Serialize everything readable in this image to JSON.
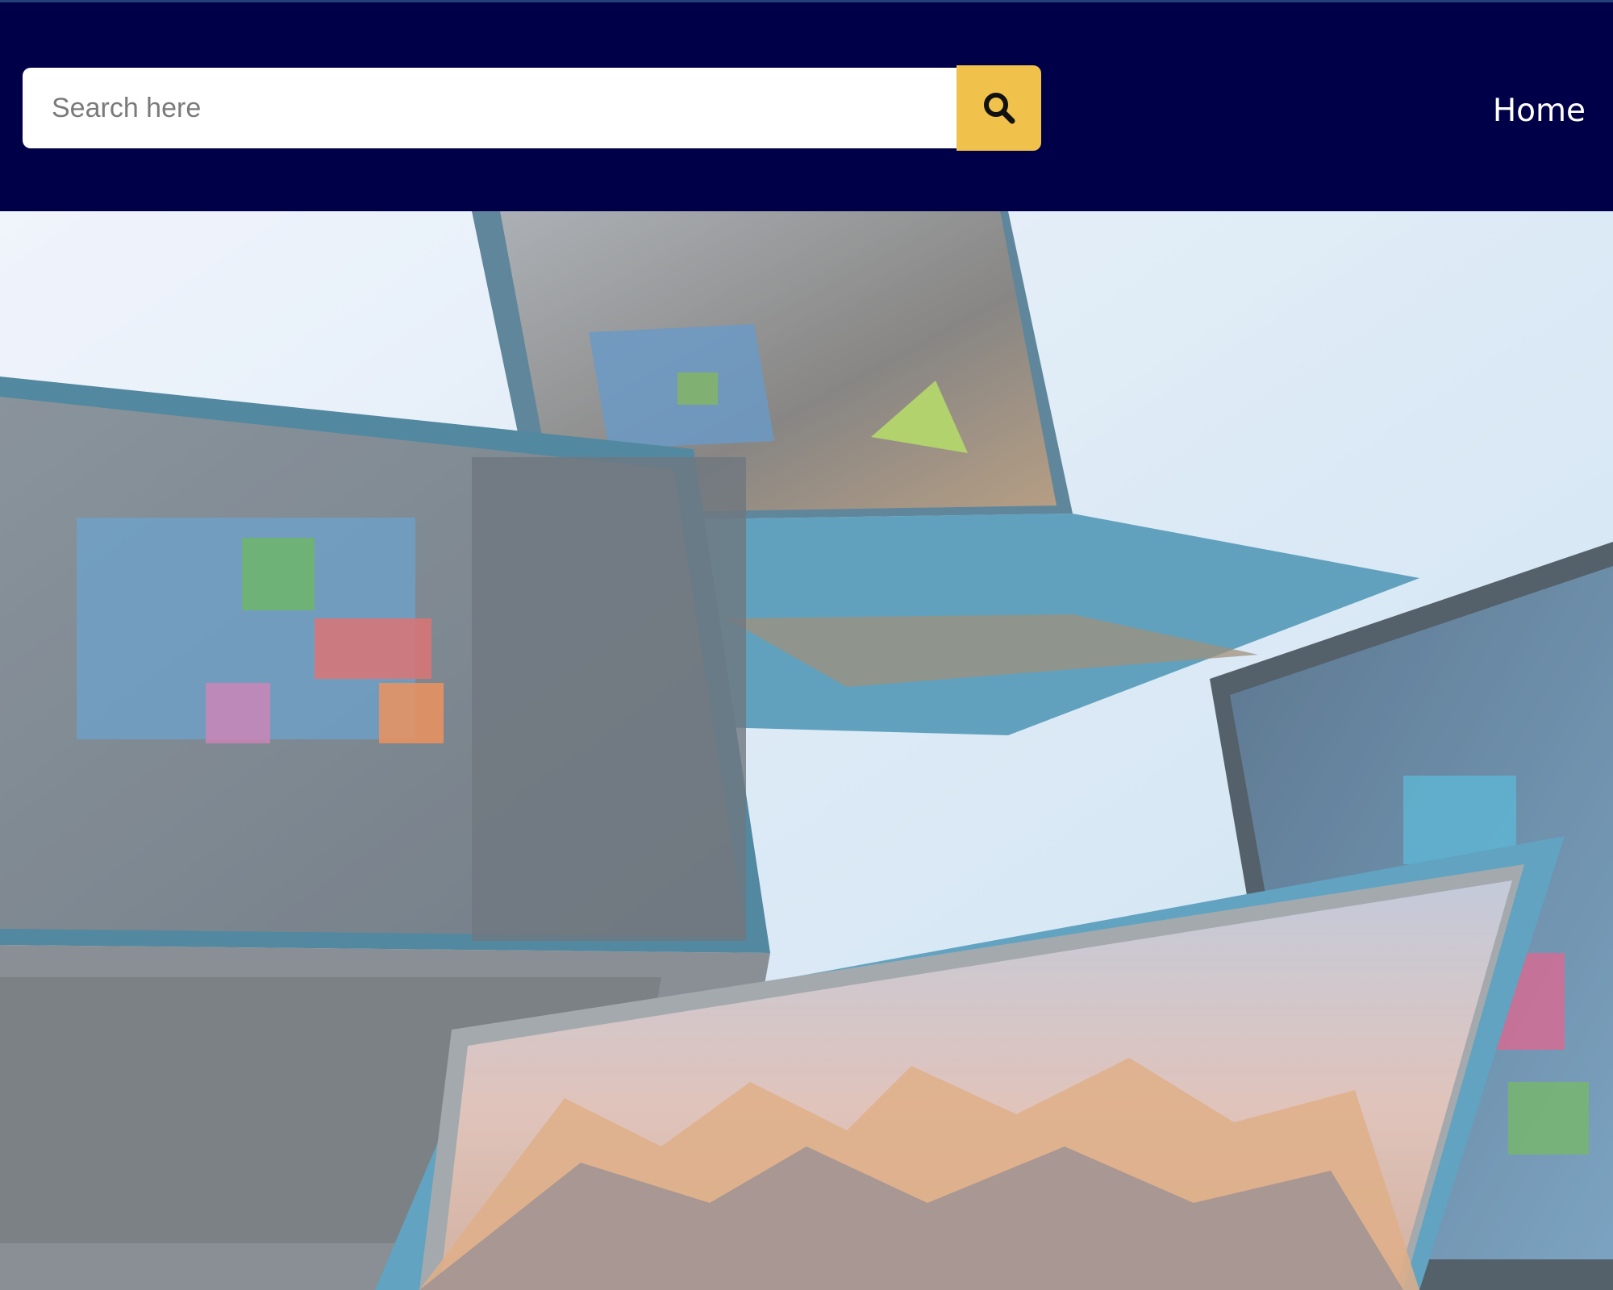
{
  "search": {
    "placeholder": "Search here",
    "button_icon": "search-icon"
  },
  "nav": {
    "home_label": "Home"
  },
  "hero": {
    "image": "laptops-banner"
  },
  "colors": {
    "header_bg": "#000048",
    "search_button_bg": "#f0c14b",
    "hero_sky": "#d6e6f4"
  }
}
